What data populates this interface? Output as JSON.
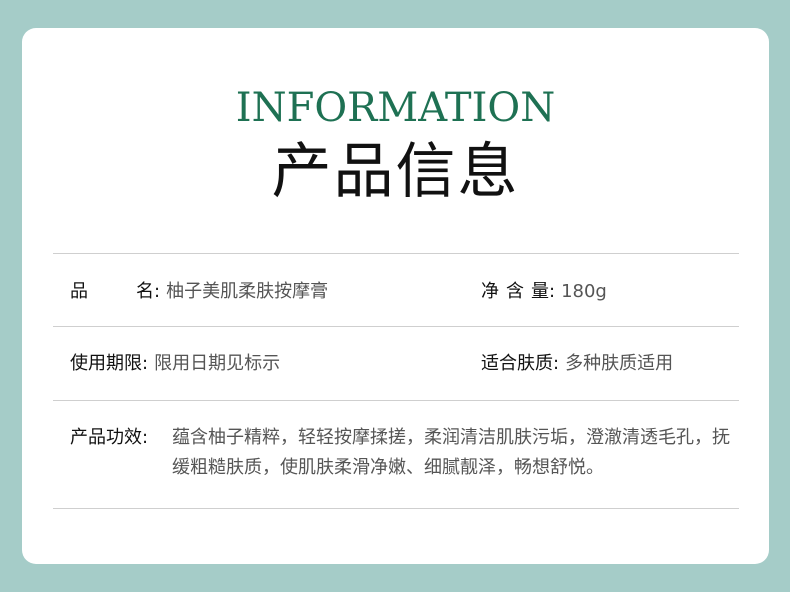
{
  "header": {
    "title_en": "INFORMATION",
    "title_cn": "产品信息"
  },
  "info": {
    "name": {
      "label_char1": "品",
      "label_char2": "名",
      "colon": ":",
      "value": "柚子美肌柔肤按摩膏"
    },
    "net_content": {
      "label_chars": [
        "净",
        "含",
        "量"
      ],
      "colon": ":",
      "value": "180g"
    },
    "shelf_life": {
      "label": "使用期限",
      "colon": ":",
      "value": "限用日期见标示"
    },
    "skin_type": {
      "label": "适合肤质",
      "colon": ":",
      "value": "多种肤质适用"
    },
    "efficacy": {
      "label": "产品功效",
      "colon": ":",
      "value": "蕴含柚子精粹，轻轻按摩揉搓，柔润清洁肌肤污垢，澄澈清透毛孔，抚缓粗糙肤质，使肌肤柔滑净嫩、细腻靓泽，畅想舒悦。"
    }
  },
  "colors": {
    "background": "#a5ccc8",
    "card": "#ffffff",
    "accent_green": "#1e7153",
    "divider": "#cfcfcf"
  }
}
